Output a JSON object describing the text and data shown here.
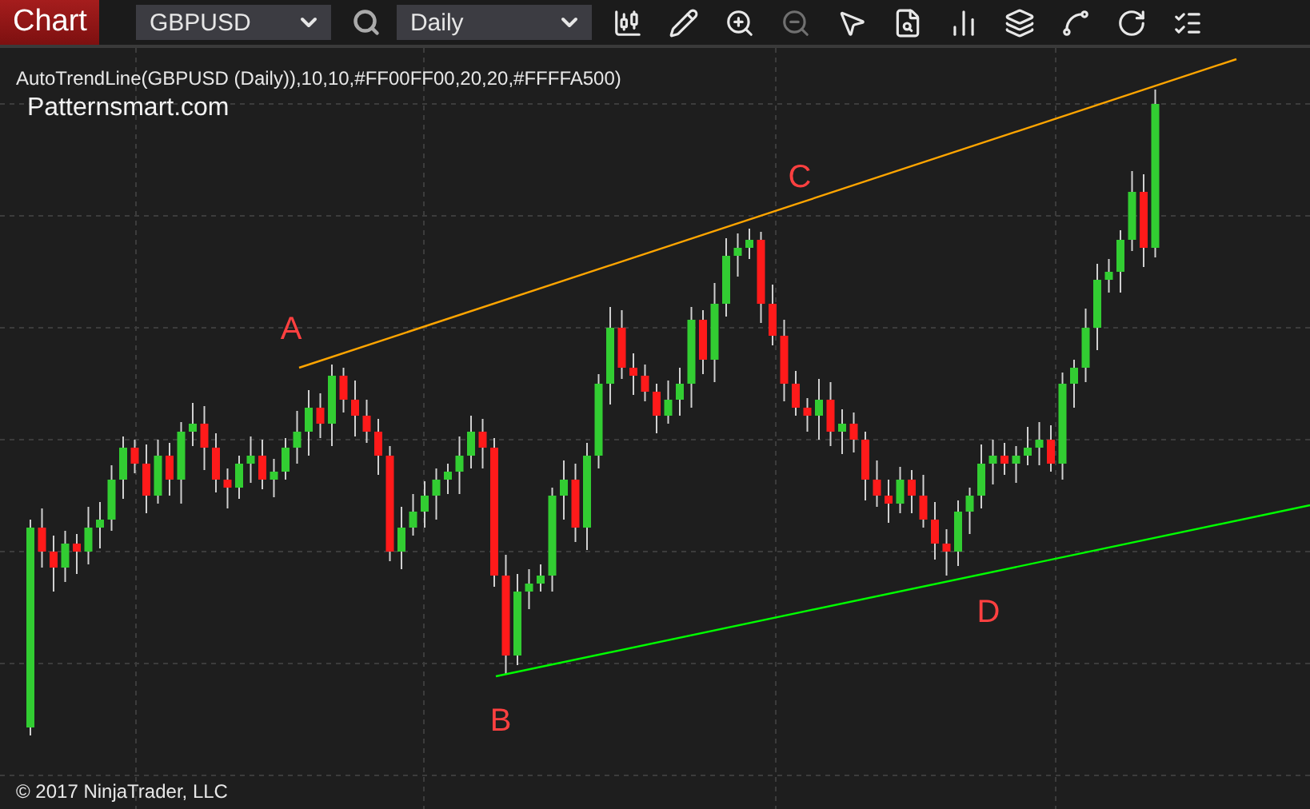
{
  "toolbar": {
    "title": "Chart",
    "instrument": "GBPUSD",
    "interval": "Daily",
    "tools": [
      {
        "kind": "candles",
        "disabled": false
      },
      {
        "kind": "pencil",
        "disabled": false
      },
      {
        "kind": "zoom-in",
        "disabled": false
      },
      {
        "kind": "zoom-out",
        "disabled": true
      },
      {
        "kind": "pointer",
        "disabled": false
      },
      {
        "kind": "data-box",
        "disabled": false
      },
      {
        "kind": "bars",
        "disabled": false
      },
      {
        "kind": "squares",
        "disabled": false
      },
      {
        "kind": "nodes",
        "disabled": false
      },
      {
        "kind": "reload",
        "disabled": false
      },
      {
        "kind": "list",
        "disabled": false
      }
    ]
  },
  "chart": {
    "indicator": "AutoTrendLine(GBPUSD (Daily)),10,10,#FF00FF00,20,20,#FFFFA500)",
    "watermark": "Patternsmart.com",
    "points": [
      "A",
      "B",
      "C",
      "D"
    ],
    "copyright": "© 2017 NinjaTrader, LLC"
  }
}
